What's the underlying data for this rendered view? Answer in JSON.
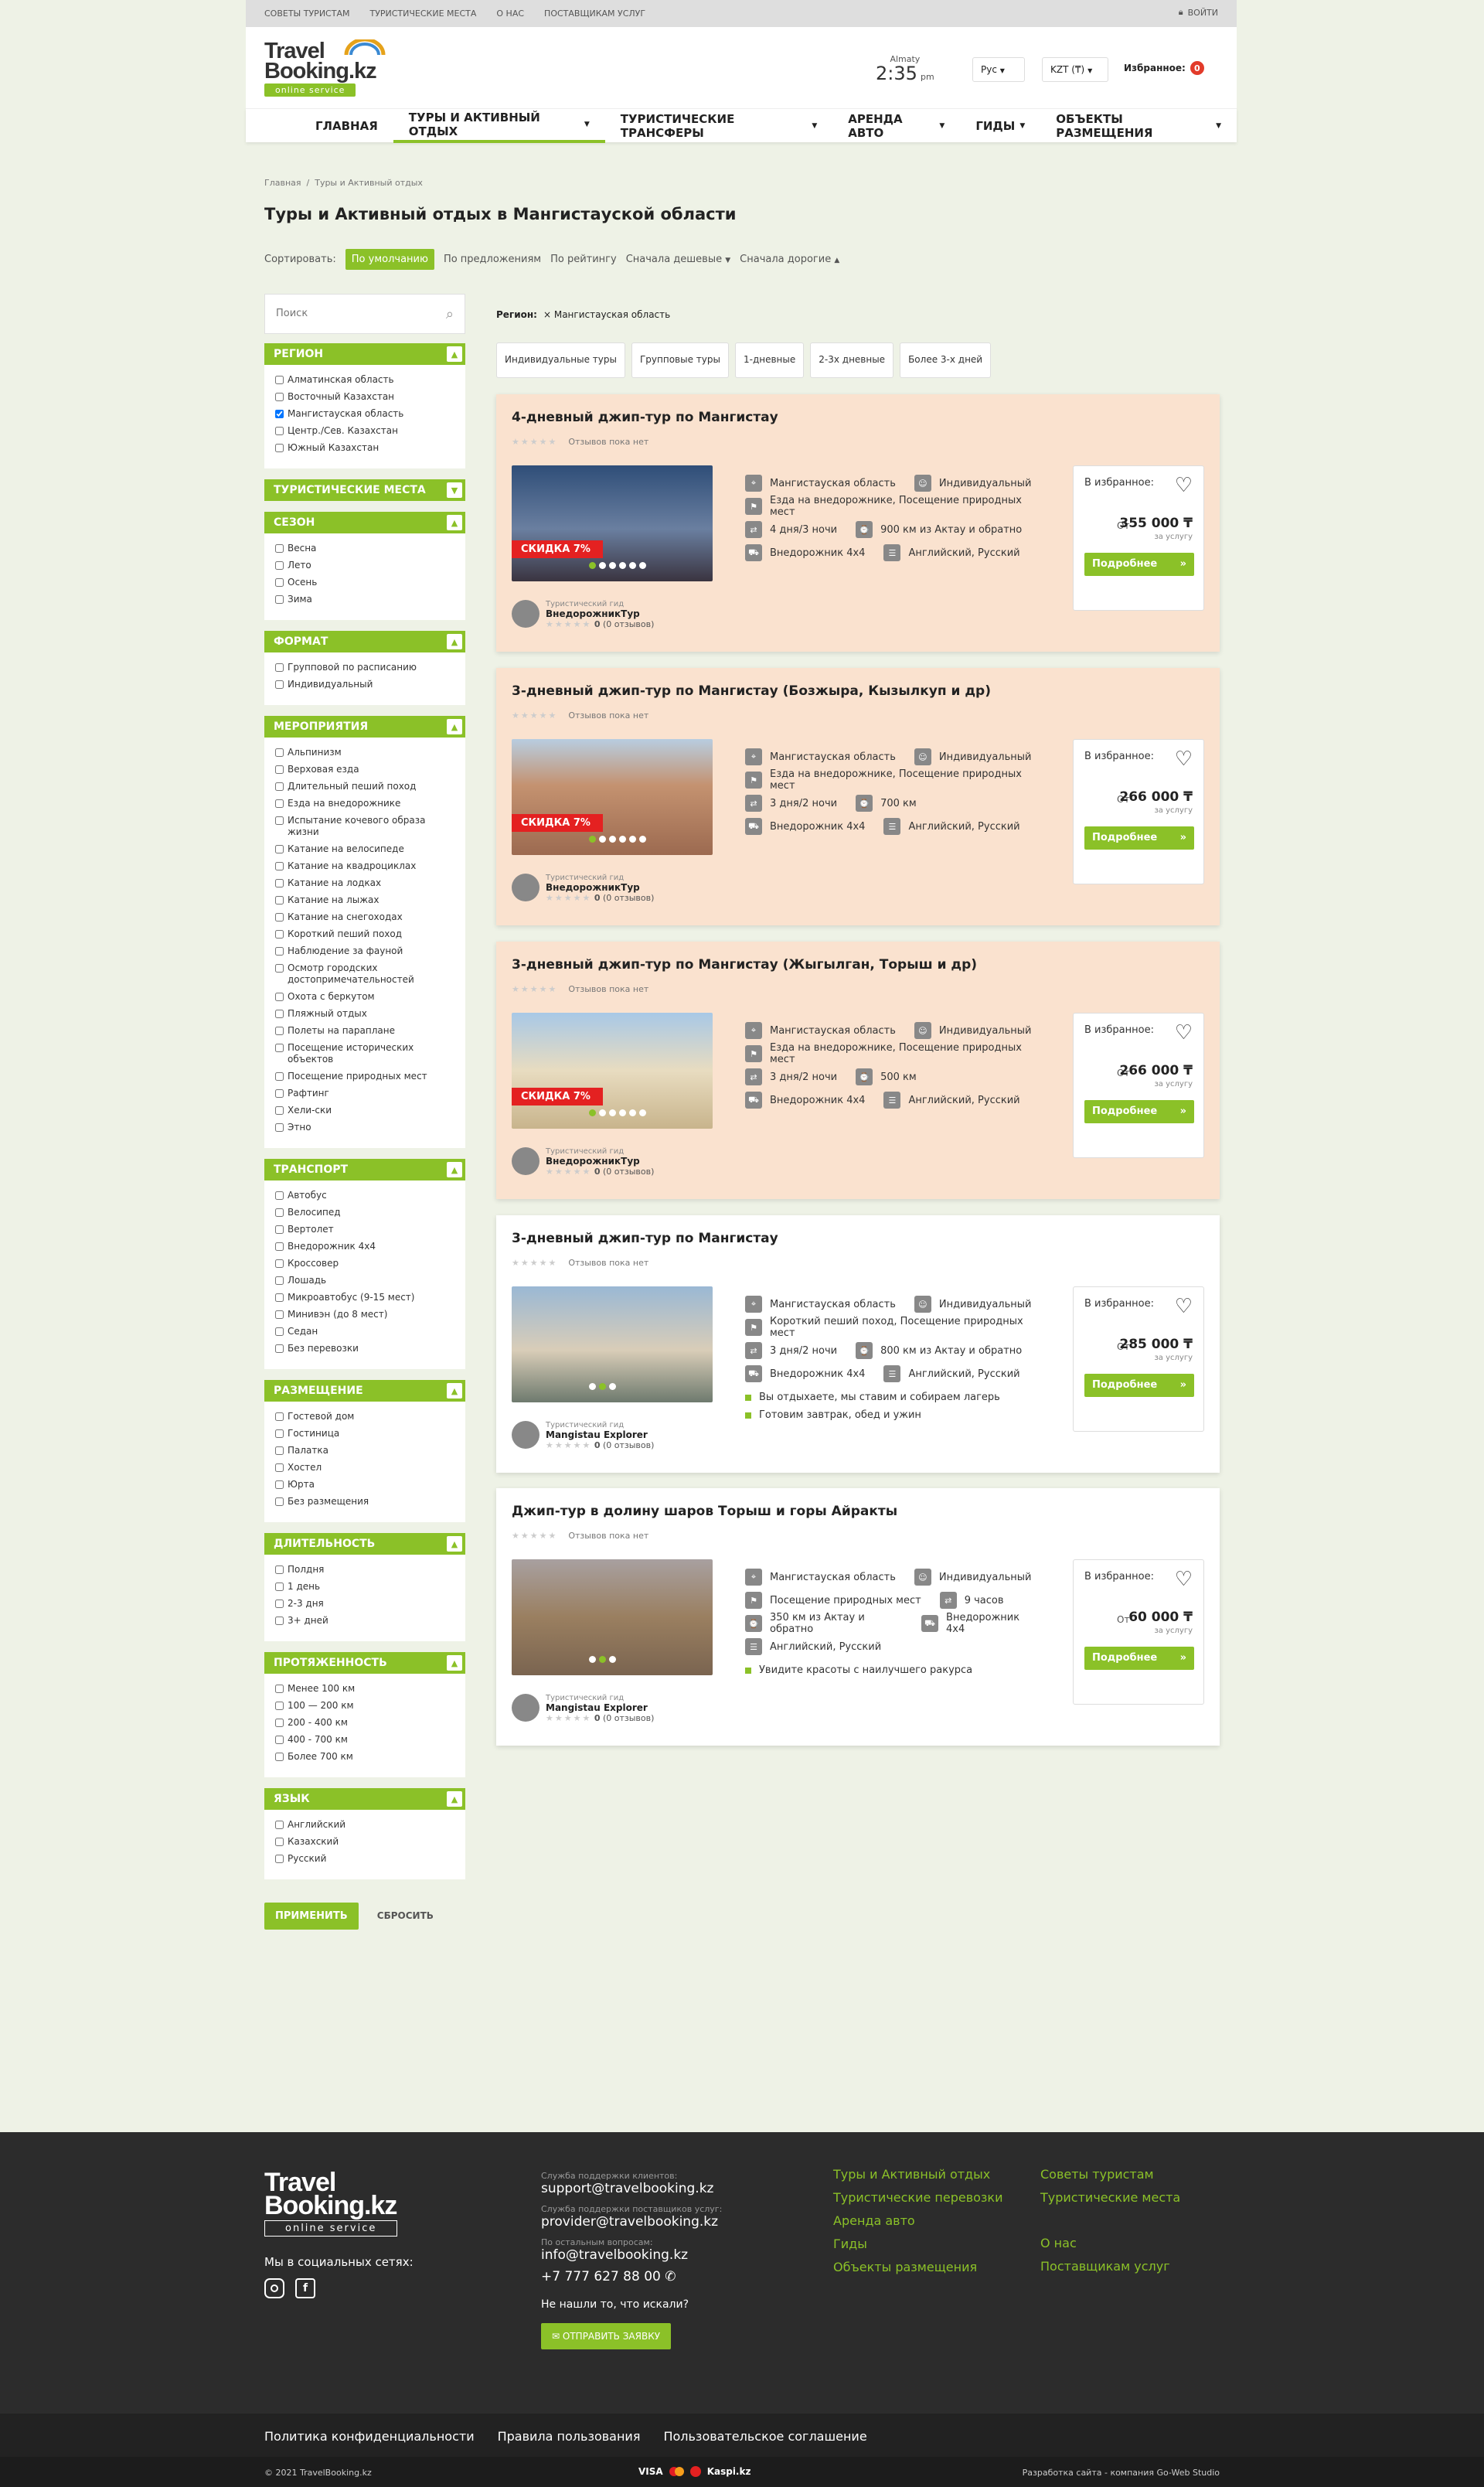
{
  "topbar": {
    "links": [
      "Советы туристам",
      "Туристические места",
      "О нас",
      "Поставщикам услуг"
    ],
    "login": "Войти"
  },
  "header": {
    "logo_line1": "Travel",
    "logo_line2": "Booking.kz",
    "logo_badge": "online service",
    "city": "Almaty",
    "time": "2:35",
    "ampm": "pm",
    "lang": "Рус",
    "currency": "KZT (₸)",
    "fav_label": "Избранное:",
    "fav_count": "0"
  },
  "nav": [
    "Главная",
    "Туры и Активный отдых",
    "Туристические трансферы",
    "Аренда авто",
    "Гиды",
    "Объекты размещения"
  ],
  "breadcrumb": [
    "Главная",
    "Туры и Активный отдых"
  ],
  "page_title": "Туры и Активный отдых в Мангистауской области",
  "sort": {
    "label": "Сортировать:",
    "options": [
      "По умолчанию",
      "По предложениям",
      "По рейтингу",
      "Сначала дешевые",
      "Сначала дорогие"
    ]
  },
  "search_placeholder": "Поиск",
  "filters": [
    {
      "title": "Регион",
      "items": [
        "Алматинская область",
        "Восточный Казахстан",
        "Мангистауская область",
        "Центр./Сев. Казахстан",
        "Южный Казахстан"
      ],
      "checked": [
        2
      ]
    },
    {
      "title": "Туристические места",
      "items": [],
      "collapsed": true
    },
    {
      "title": "Сезон",
      "items": [
        "Весна",
        "Лето",
        "Осень",
        "Зима"
      ]
    },
    {
      "title": "Формат",
      "items": [
        "Групповой по расписанию",
        "Индивидуальный"
      ]
    },
    {
      "title": "Мероприятия",
      "items": [
        "Альпинизм",
        "Верховая езда",
        "Длительный пеший поход",
        "Езда на внедорожнике",
        "Испытание кочевого образа жизни",
        "Катание на велосипеде",
        "Катание на квадроциклах",
        "Катание на лодках",
        "Катание на лыжах",
        "Катание на снегоходах",
        "Короткий пеший поход",
        "Наблюдение за фауной",
        "Осмотр городских достопримечательностей",
        "Охота с беркутом",
        "Пляжный отдых",
        "Полеты на параплане",
        "Посещение исторических объектов",
        "Посещение природных мест",
        "Рафтинг",
        "Хели-ски",
        "Этно"
      ]
    },
    {
      "title": "Транспорт",
      "items": [
        "Автобус",
        "Велосипед",
        "Вертолет",
        "Внедорожник 4х4",
        "Кроссовер",
        "Лошадь",
        "Микроавтобус (9-15 мест)",
        "Минивэн (до 8 мест)",
        "Седан",
        "Без перевозки"
      ]
    },
    {
      "title": "Размещение",
      "items": [
        "Гостевой дом",
        "Гостиница",
        "Палатка",
        "Хостел",
        "Юрта",
        "Без размещения"
      ]
    },
    {
      "title": "Длительность",
      "items": [
        "Полдня",
        "1 день",
        "2-3 дня",
        "3+ дней"
      ]
    },
    {
      "title": "Протяженность",
      "items": [
        "Менее 100 км",
        "100 — 200 км",
        "200 - 400 км",
        "400 - 700 км",
        "Более 700 км"
      ]
    },
    {
      "title": "Язык",
      "items": [
        "Английский",
        "Казахский",
        "Русский"
      ]
    }
  ],
  "apply_label": "Применить",
  "reset_label": "Сбросить",
  "region_label": "Регион:",
  "region_chip": "Мангистауская область",
  "type_chips": [
    "Индивидуальные туры",
    "Групповые туры",
    "1-дневные",
    "2-3х дневные",
    "Более 3-х дней"
  ],
  "cards": [
    {
      "title": "4-дневный джип-тур по Мангистау",
      "reviews": "Отзывов пока нет",
      "discount": "Скидка 7%",
      "highlight": true,
      "info": [
        [
          "Мангистауская область",
          "Индивидуальный"
        ],
        [
          "Езда на внедорожнике, Посещение природных мест"
        ],
        [
          "4 дня/3 ночи",
          "900 км из Актау и обратно"
        ],
        [
          "Внедорожник 4х4",
          "Английский, Русский"
        ]
      ],
      "bullets": [],
      "guide_label": "Туристический гид",
      "guide": "ВнедорожникТур",
      "guide_rating": "0",
      "guide_reviews": "(0 отзывов)",
      "fav": "В избранное:",
      "from": "От",
      "price": "355 000 ₸",
      "per": "за услугу",
      "more": "Подробнее",
      "photo": "#3c5a82"
    },
    {
      "title": "3-дневный джип-тур по Мангистау (Бозжыра, Кызылкуп и др)",
      "reviews": "Отзывов пока нет",
      "discount": "Скидка 7%",
      "highlight": true,
      "info": [
        [
          "Мангистауская область",
          "Индивидуальный"
        ],
        [
          "Езда на внедорожнике, Посещение природных мест"
        ],
        [
          "3 дня/2 ночи",
          "700 км"
        ],
        [
          "Внедорожник 4х4",
          "Английский, Русский"
        ]
      ],
      "bullets": [],
      "guide_label": "Туристический гид",
      "guide": "ВнедорожникТур",
      "guide_rating": "0",
      "guide_reviews": "(0 отзывов)",
      "fav": "В избранное:",
      "from": "От",
      "price": "266 000 ₸",
      "per": "за услугу",
      "more": "Подробнее",
      "photo": "#c49270"
    },
    {
      "title": "3-дневный джип-тур по Мангистау (Жыгылган, Торыш и др)",
      "reviews": "Отзывов пока нет",
      "discount": "Скидка 7%",
      "highlight": true,
      "info": [
        [
          "Мангистауская область",
          "Индивидуальный"
        ],
        [
          "Езда на внедорожнике, Посещение природных мест"
        ],
        [
          "3 дня/2 ночи",
          "500 км"
        ],
        [
          "Внедорожник 4х4",
          "Английский, Русский"
        ]
      ],
      "bullets": [],
      "guide_label": "Туристический гид",
      "guide": "ВнедорожникТур",
      "guide_rating": "0",
      "guide_reviews": "(0 отзывов)",
      "fav": "В избранное:",
      "from": "От",
      "price": "266 000 ₸",
      "per": "за услугу",
      "more": "Подробнее",
      "photo": "#d8c8a2"
    },
    {
      "title": "3-дневный джип-тур по Мангистау",
      "reviews": "Отзывов пока нет",
      "discount": "",
      "highlight": false,
      "info": [
        [
          "Мангистауская область",
          "Индивидуальный"
        ],
        [
          "Короткий пеший поход, Посещение природных мест"
        ],
        [
          "3 дня/2 ночи",
          "800 км из Актау и обратно"
        ],
        [
          "Внедорожник 4х4",
          "Английский, Русский"
        ]
      ],
      "bullets": [
        "Вы отдыхаете, мы ставим и собираем лагерь",
        "Готовим завтрак, обед и ужин"
      ],
      "guide_label": "Туристический гид",
      "guide": "Mangistau Explorer",
      "guide_rating": "0",
      "guide_reviews": "(0 отзывов)",
      "fav": "В избранное:",
      "from": "От",
      "price": "285 000 ₸",
      "per": "за услугу",
      "more": "Подробнее",
      "photo": "#8fa0a8"
    },
    {
      "title": "Джип-тур в долину шаров Торыш и горы Айракты",
      "reviews": "Отзывов пока нет",
      "discount": "",
      "highlight": false,
      "info": [
        [
          "Мангистауская область",
          "Индивидуальный"
        ],
        [
          "Посещение природных мест",
          "9 часов"
        ],
        [
          "350 км из Актау и обратно",
          "Внедорожник 4х4"
        ],
        [
          "Английский, Русский"
        ]
      ],
      "bullets": [
        "Увидите красоты с наилучшего ракурса"
      ],
      "guide_label": "Туристический гид",
      "guide": "Mangistau Explorer",
      "guide_rating": "0",
      "guide_reviews": "(0 отзывов)",
      "fav": "В избранное:",
      "from": "От",
      "price": "60 000 ₸",
      "per": "за услугу",
      "more": "Подробнее",
      "photo": "#9a7f60"
    }
  ],
  "footer": {
    "social_label": "Мы в социальных сетях:",
    "support_label": "Служба поддержки клиентов:",
    "support_email": "support@travelbooking.kz",
    "provider_label": "Служба поддержки поставщиков услуг:",
    "provider_email": "provider@travelbooking.kz",
    "other_label": "По остальным вопросам:",
    "info_email": "info@travelbooking.kz",
    "phone": "+7 777 627 88 00",
    "not_found": "Не нашли то, что искали?",
    "send": "Отправить заявку",
    "col1": [
      "Туры и Активный отдых",
      "Туристические перевозки",
      "Аренда авто",
      "Гиды",
      "Объекты размещения"
    ],
    "col2": [
      "Советы туристам",
      "Туристические места",
      "",
      "О нас",
      "Поставщикам услуг"
    ],
    "legal": [
      "Политика конфиденциальности",
      "Правила пользования",
      "Пользовательское соглашение"
    ],
    "copyright": "© 2021 TravelBooking.kz",
    "payments": "VISA",
    "kaspi": "Kaspi.kz",
    "dev": "Разработка сайта - компания Go-Web Studio"
  }
}
